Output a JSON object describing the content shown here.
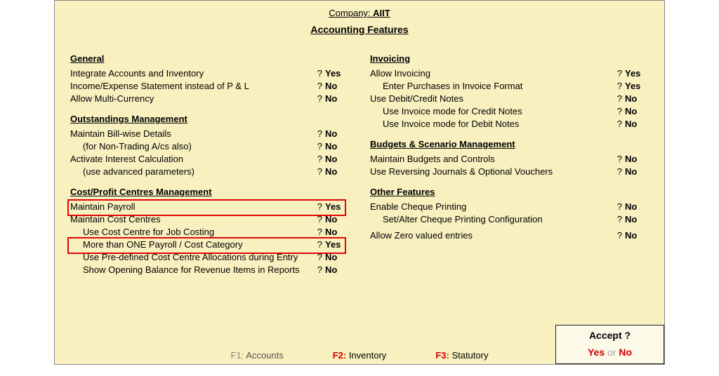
{
  "header": {
    "company_prefix": "Company:",
    "company_name": "AIIT",
    "title": "Accounting Features"
  },
  "left": {
    "general": {
      "heading": "General",
      "integrate": {
        "label": "Integrate Accounts and Inventory",
        "val": "Yes"
      },
      "income_expense": {
        "label": "Income/Expense Statement instead of P & L",
        "val": "No"
      },
      "multi_currency": {
        "label": "Allow Multi-Currency",
        "val": "No"
      }
    },
    "outstandings": {
      "heading": "Outstandings Management",
      "billwise": {
        "label": "Maintain Bill-wise Details",
        "val": "No"
      },
      "billwise_sub": {
        "label": "(for Non-Trading A/cs also)",
        "val": "No"
      },
      "interest": {
        "label": "Activate Interest Calculation",
        "val": "No"
      },
      "interest_sub": {
        "label": "(use advanced parameters)",
        "val": "No"
      }
    },
    "cost": {
      "heading": "Cost/Profit Centres Management",
      "payroll": {
        "label": "Maintain Payroll",
        "val": "Yes"
      },
      "cost_centres": {
        "label": "Maintain Cost Centres",
        "val": "No"
      },
      "job_costing": {
        "label": "Use Cost Centre for Job Costing",
        "val": "No"
      },
      "more_than_one": {
        "label": "More than ONE Payroll / Cost Category",
        "val": "Yes"
      },
      "predefined": {
        "label": "Use Pre-defined Cost Centre Allocations during Entry",
        "val": "No"
      },
      "opening_bal": {
        "label": "Show Opening Balance for Revenue Items in Reports",
        "val": "No"
      }
    }
  },
  "right": {
    "invoicing": {
      "heading": "Invoicing",
      "allow": {
        "label": "Allow Invoicing",
        "val": "Yes"
      },
      "purchases": {
        "label": "Enter Purchases in Invoice Format",
        "val": "Yes"
      },
      "dc_notes": {
        "label": "Use Debit/Credit Notes",
        "val": "No"
      },
      "credit_mode": {
        "label": "Use Invoice mode for Credit Notes",
        "val": "No"
      },
      "debit_mode": {
        "label": "Use Invoice mode for Debit Notes",
        "val": "No"
      }
    },
    "budgets": {
      "heading": "Budgets & Scenario Management",
      "maintain": {
        "label": "Maintain Budgets and Controls",
        "val": "No"
      },
      "reversing": {
        "label": "Use Reversing Journals & Optional Vouchers",
        "val": "No"
      }
    },
    "other": {
      "heading": "Other Features",
      "cheque": {
        "label": "Enable Cheque Printing",
        "val": "No"
      },
      "cheque_cfg": {
        "label": "Set/Alter Cheque Printing Configuration",
        "val": "No"
      },
      "zero": {
        "label": "Allow Zero valued entries",
        "val": "No"
      }
    }
  },
  "footer": {
    "f1": {
      "key": "F1:",
      "label": "Accounts"
    },
    "f2": {
      "key": "F2:",
      "label": "Inventory"
    },
    "f3": {
      "key": "F3:",
      "label": "Statutory"
    }
  },
  "accept": {
    "question": "Accept ?",
    "yes": "Yes",
    "or": "or",
    "no": "No"
  },
  "q": "?"
}
